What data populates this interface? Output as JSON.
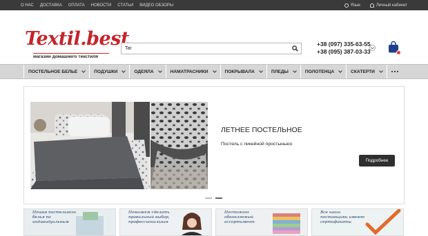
{
  "topbar": {
    "links": [
      "О НАС",
      "ДОСТАВКА",
      "ОПЛАТА",
      "НОВОСТИ",
      "СТАТЬИ",
      "ВИДЕО ОБЗОРЫ"
    ],
    "language": "Язык",
    "account": "Личный кабинет"
  },
  "header": {
    "logo_name": "Textil.best",
    "logo_slogan": "магазин домашнего текстиля",
    "search_value": "Tar",
    "phone1": "+38 (097) 335-63-55",
    "phone2": "+38 (095) 387-03-33"
  },
  "nav": {
    "items": [
      "ПОСТЕЛЬНОЕ БЕЛЬЕ",
      "ПОДУШКИ",
      "ОДЕЯЛА",
      "НАМАТРАСНИКИ",
      "ПОКРЫВАЛА",
      "ПЛЕДЫ",
      "ПОЛОТЕНЦА",
      "СКАТЕРТИ"
    ]
  },
  "slider": {
    "title": "ЛЕТНЕЕ ПОСТЕЛЬНОЕ",
    "subtitle": "Постель с пикейной простыньюо",
    "button": "Подробнее",
    "slide_count": 2,
    "active_slide": 2
  },
  "banners": [
    "Пошив постельного белья по индивидуальным",
    "Поможем сделать правильный выбор, профессиональная",
    "Постоянно обновляемый ассортимент",
    "Все наши поставщики имеют сертификаты"
  ],
  "colors": {
    "brand_red": "#c4252b",
    "topbar_bg": "#3a3a3a",
    "nav_bg": "#d6d6d6",
    "button_bg": "#2f2f2f",
    "cart_blue": "#1f3f8f"
  }
}
